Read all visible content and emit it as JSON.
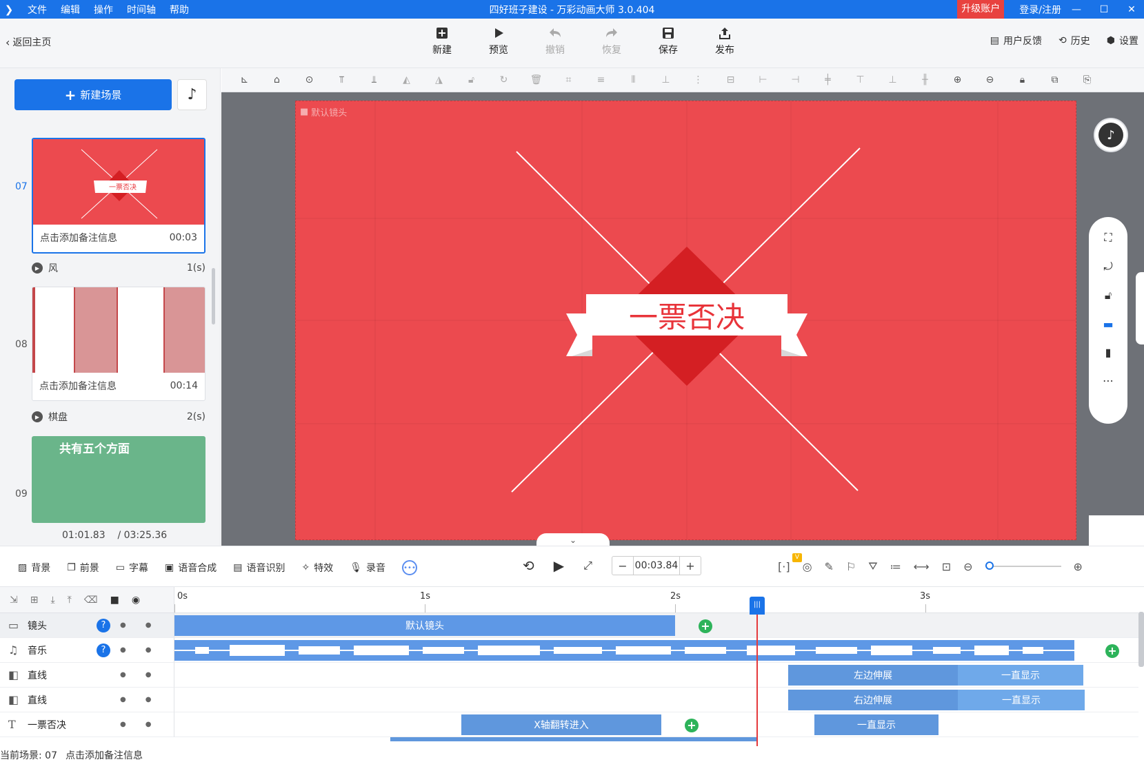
{
  "app": {
    "title": "四好班子建设 - 万彩动画大师 3.0.404",
    "menu": [
      "文件",
      "编辑",
      "操作",
      "时间轴",
      "帮助"
    ],
    "upgrade": "升级账户",
    "login": "登录/注册"
  },
  "toolbar": {
    "back": "返回主页",
    "tools": [
      {
        "label": "新建",
        "icon": "plus-square-icon",
        "enabled": true
      },
      {
        "label": "预览",
        "icon": "play-icon",
        "enabled": true
      },
      {
        "label": "撤销",
        "icon": "undo-icon",
        "enabled": false
      },
      {
        "label": "恢复",
        "icon": "redo-icon",
        "enabled": false
      },
      {
        "label": "保存",
        "icon": "save-icon",
        "enabled": true
      },
      {
        "label": "发布",
        "icon": "publish-icon",
        "enabled": true
      }
    ],
    "right": [
      {
        "label": "用户反馈",
        "icon": "feedback-icon"
      },
      {
        "label": "历史",
        "icon": "history-icon"
      },
      {
        "label": "设置",
        "icon": "gear-icon"
      }
    ]
  },
  "left_panel": {
    "new_scene": "新建场景",
    "scenes": [
      {
        "num": "07",
        "note": "点击添加备注信息",
        "time": "00:03",
        "active": true,
        "thumb_text": "一票否决"
      },
      {
        "num": "08",
        "note": "点击添加备注信息",
        "time": "00:14",
        "active": false
      },
      {
        "num": "09",
        "note": "",
        "time": "",
        "active": false,
        "thumb_text": "共有五个方面"
      }
    ],
    "transitions": [
      {
        "name": "风",
        "dur": "1(s)"
      },
      {
        "name": "棋盘",
        "dur": "2(s)"
      }
    ],
    "time_current": "01:01.83",
    "time_total": "/ 03:25.36"
  },
  "canvas": {
    "camera_label": "默认镜头",
    "banner_text": "一票否决",
    "colors": {
      "bg": "#ec4a4f",
      "diamond": "#d41f23",
      "banner": "#ffffff",
      "text": "#e8343a"
    }
  },
  "bottom_tools": {
    "items": [
      {
        "label": "背景",
        "icon": "background-icon"
      },
      {
        "label": "前景",
        "icon": "foreground-icon"
      },
      {
        "label": "字幕",
        "icon": "subtitle-icon"
      },
      {
        "label": "语音合成",
        "icon": "tts-icon"
      },
      {
        "label": "语音识别",
        "icon": "asr-icon"
      },
      {
        "label": "特效",
        "icon": "effects-icon"
      },
      {
        "label": "录音",
        "icon": "mic-icon"
      }
    ],
    "time": "00:03.84",
    "v_badge": "V"
  },
  "timeline": {
    "ruler": [
      "0s",
      "1s",
      "2s",
      "3s"
    ],
    "tracks": [
      {
        "name": "镜头",
        "icon": "camera-icon",
        "help": true
      },
      {
        "name": "音乐",
        "icon": "music-icon",
        "help": true
      },
      {
        "name": "直线",
        "icon": "shape-icon",
        "help": false
      },
      {
        "name": "直线",
        "icon": "shape-icon",
        "help": false
      },
      {
        "name": "一票否决",
        "icon": "text-icon",
        "help": false
      }
    ],
    "clips": {
      "camera": "默认镜头",
      "line1_a": "左边伸展",
      "line1_b": "一直显示",
      "line2_a": "右边伸展",
      "line2_b": "一直显示",
      "text_a": "X轴翻转进入",
      "text_b": "一直显示"
    }
  },
  "status": {
    "scene": "当前场景: 07",
    "note": "点击添加备注信息"
  }
}
